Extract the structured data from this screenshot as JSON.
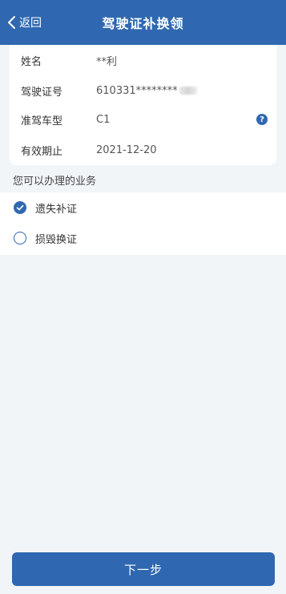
{
  "header": {
    "back_label": "返回",
    "title": "驾驶证补换领"
  },
  "info": {
    "rows": [
      {
        "label": "姓名",
        "value": "**利"
      },
      {
        "label": "驾驶证号",
        "value": "610331********"
      },
      {
        "label": "准驾车型",
        "value": "C1"
      },
      {
        "label": "有效期止",
        "value": "2021-12-20"
      }
    ],
    "help_glyph": "?"
  },
  "services": {
    "title": "您可以办理的业务",
    "options": [
      {
        "label": "遗失补证",
        "checked": true
      },
      {
        "label": "损毁换证",
        "checked": false
      }
    ]
  },
  "footer": {
    "next_label": "下一步"
  },
  "colors": {
    "brand": "#2f68b0",
    "background": "#f2f5f8"
  }
}
